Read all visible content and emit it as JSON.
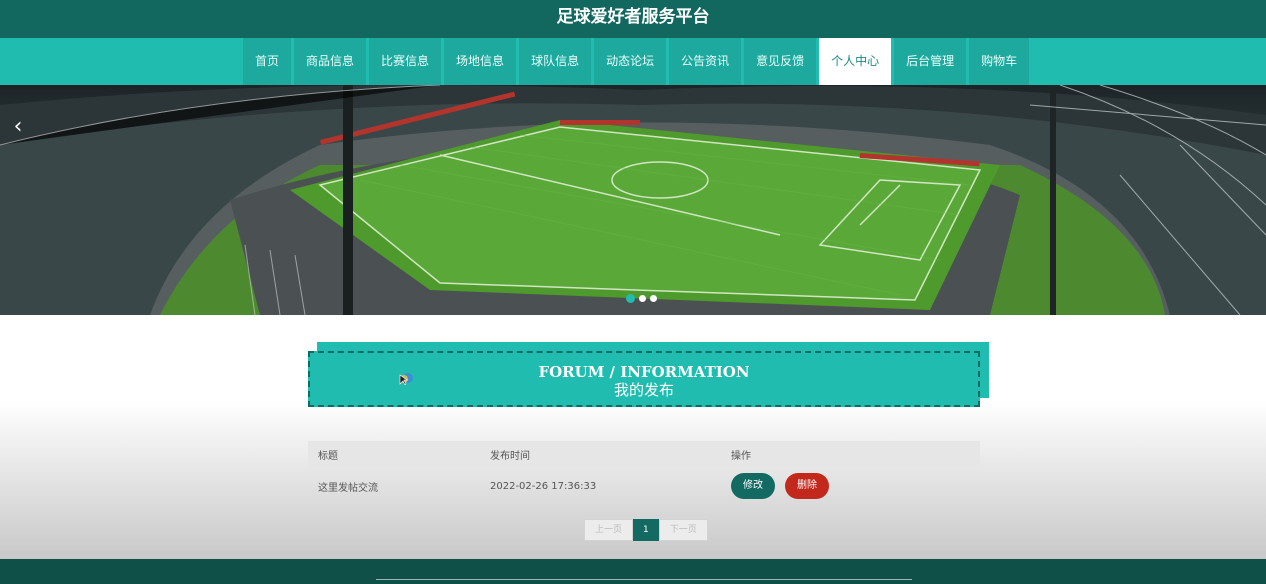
{
  "header": {
    "title": "足球爱好者服务平台"
  },
  "nav": {
    "items": [
      {
        "label": "首页"
      },
      {
        "label": "商品信息"
      },
      {
        "label": "比赛信息"
      },
      {
        "label": "场地信息"
      },
      {
        "label": "球队信息"
      },
      {
        "label": "动态论坛"
      },
      {
        "label": "公告资讯"
      },
      {
        "label": "意见反馈"
      },
      {
        "label": "个人中心",
        "active": true
      },
      {
        "label": "后台管理"
      },
      {
        "label": "购物车"
      }
    ]
  },
  "banner": {
    "prev_icon": "chevron-left-icon",
    "slide_count": 3,
    "active_slide": 1
  },
  "section": {
    "title_en": "FORUM / INFORMATION",
    "title_cn": "我的发布"
  },
  "table": {
    "headers": [
      "标题",
      "发布时间",
      "操作"
    ],
    "rows": [
      {
        "title": "这里发帖交流",
        "time": "2022-02-26 17:36:33",
        "edit_label": "修改",
        "delete_label": "删除"
      }
    ]
  },
  "pagination": {
    "prev": "上一页",
    "current": "1",
    "next": "下一页"
  },
  "colors": {
    "primary": "#21bcb0",
    "dark": "#12675f",
    "danger": "#c3281c"
  }
}
